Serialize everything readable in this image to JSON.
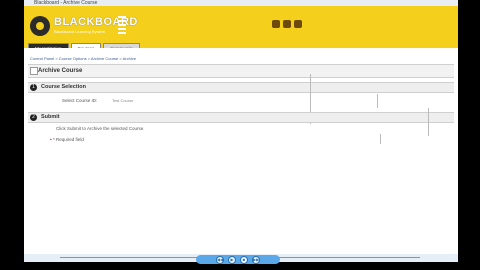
{
  "window": {
    "title": "Blackboard - Archive Course"
  },
  "logo": {
    "text": "BLACKBOARD",
    "tagline": "Blackboard Learning System"
  },
  "header": {
    "icon_labels": [
      "",
      "",
      ""
    ]
  },
  "tabs": [
    {
      "label": "My Institution"
    },
    {
      "label": "Courses"
    },
    {
      "label": "Community"
    }
  ],
  "breadcrumb": "Control Panel > Course Options > Archive Course > Archive",
  "page_title": "Archive Course",
  "steps": [
    {
      "num": "1",
      "title": "Course Selection"
    },
    {
      "num": "2",
      "title": "Submit"
    }
  ],
  "fields": {
    "course_id_label": "Select Course ID:",
    "course_id_value": "Test Course",
    "submit_text": "Click Submit to Archive the selected Course.",
    "required_text": "* Required field"
  },
  "player": {
    "controls": [
      "◀◀",
      "▶",
      "■",
      "▶▶"
    ]
  },
  "colors": {
    "header": "#f4cf1b",
    "tab_dark": "#2b2b2b",
    "player": "#5aa8e8"
  }
}
